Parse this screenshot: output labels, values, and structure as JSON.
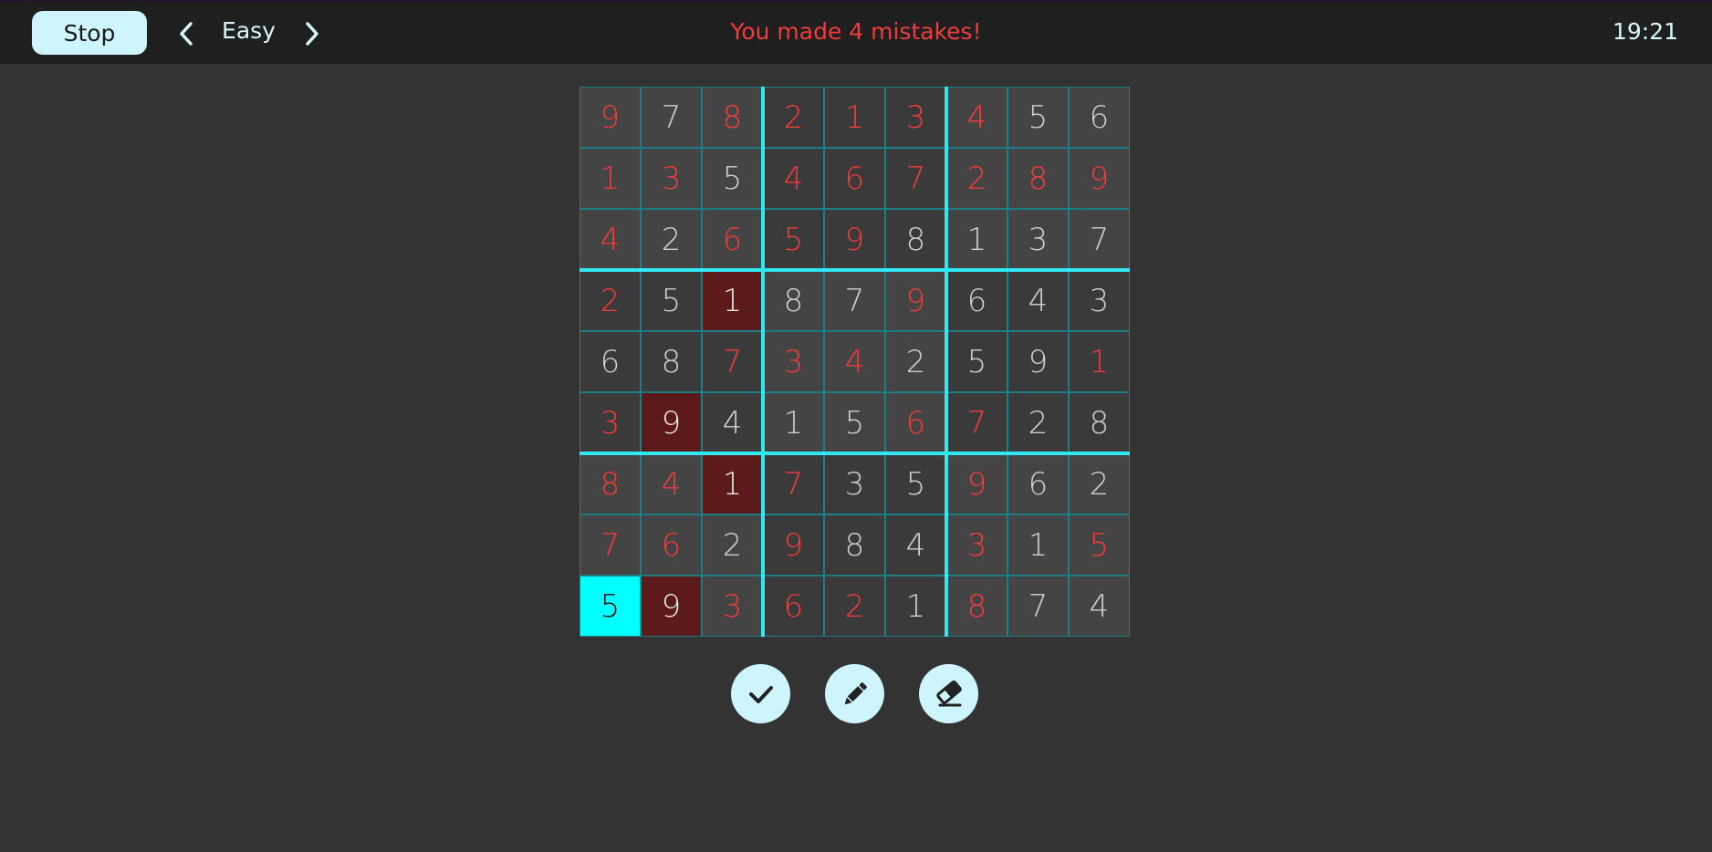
{
  "header": {
    "stop_label": "Stop",
    "difficulty": "Easy",
    "status_message": "You made 4 mistakes!",
    "timer": "19:21",
    "prev_icon": "chevron-left-icon",
    "next_icon": "chevron-right-icon"
  },
  "colors": {
    "background": "#333333",
    "topbar": "#1f1f1f",
    "accent": "#2fe8f0",
    "error_text": "#f03c3c",
    "given_text": "#cfcfcf",
    "cell_bg": "#444444",
    "cell_bg_alt": "#3a3a3a",
    "mistake_bg": "#5c1a1a",
    "selected_bg": "#00ffff"
  },
  "board": {
    "values": [
      [
        9,
        7,
        8,
        2,
        1,
        3,
        4,
        5,
        6
      ],
      [
        1,
        3,
        5,
        4,
        6,
        7,
        2,
        8,
        9
      ],
      [
        4,
        2,
        6,
        5,
        9,
        8,
        1,
        3,
        7
      ],
      [
        2,
        5,
        1,
        8,
        7,
        9,
        6,
        4,
        3
      ],
      [
        6,
        8,
        7,
        3,
        4,
        2,
        5,
        9,
        1
      ],
      [
        3,
        9,
        4,
        1,
        5,
        6,
        7,
        2,
        8
      ],
      [
        8,
        4,
        1,
        7,
        3,
        5,
        9,
        6,
        2
      ],
      [
        7,
        6,
        2,
        9,
        8,
        4,
        3,
        1,
        5
      ],
      [
        5,
        9,
        3,
        6,
        2,
        1,
        8,
        7,
        4
      ]
    ],
    "user_entered": [
      [
        1,
        0,
        1,
        1,
        1,
        1,
        1,
        0,
        0
      ],
      [
        1,
        1,
        0,
        1,
        1,
        1,
        1,
        1,
        1
      ],
      [
        1,
        0,
        1,
        1,
        1,
        0,
        0,
        0,
        0
      ],
      [
        1,
        0,
        0,
        0,
        0,
        1,
        0,
        0,
        0
      ],
      [
        0,
        0,
        1,
        1,
        1,
        0,
        0,
        0,
        1
      ],
      [
        1,
        0,
        0,
        0,
        0,
        1,
        1,
        0,
        0
      ],
      [
        1,
        1,
        0,
        1,
        0,
        0,
        1,
        0,
        0
      ],
      [
        1,
        1,
        0,
        1,
        0,
        0,
        1,
        0,
        1
      ],
      [
        0,
        0,
        1,
        1,
        1,
        0,
        1,
        0,
        0
      ]
    ],
    "mistakes": [
      [
        3,
        2
      ],
      [
        5,
        1
      ],
      [
        6,
        2
      ],
      [
        8,
        1
      ]
    ],
    "selected": [
      8,
      0
    ]
  },
  "tools": [
    {
      "name": "check-button",
      "icon": "check-icon"
    },
    {
      "name": "pencil-button",
      "icon": "pencil-icon"
    },
    {
      "name": "eraser-button",
      "icon": "eraser-icon"
    }
  ]
}
